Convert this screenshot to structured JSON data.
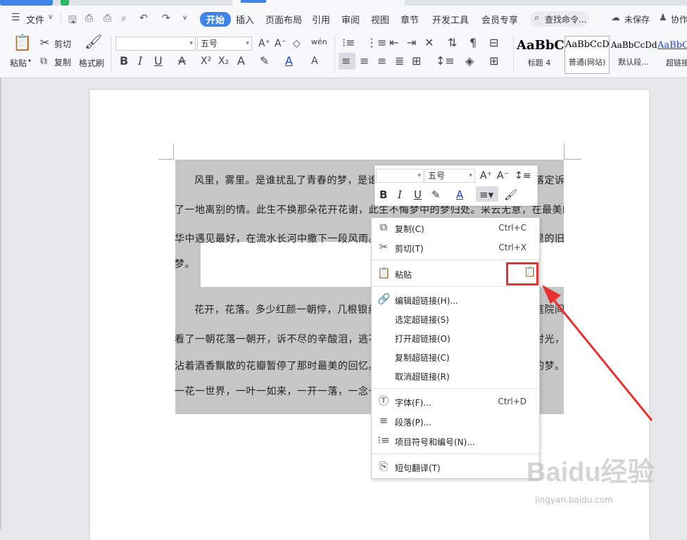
{
  "menubar": {
    "file": "文件",
    "tabs": [
      "开始",
      "插入",
      "页面布局",
      "引用",
      "审阅",
      "视图",
      "章节",
      "开发工具",
      "会员专享"
    ],
    "search": "查找命令...",
    "unsaved": "未保存",
    "collab": "协作"
  },
  "ribbon": {
    "paste": "粘贴",
    "cut": "剪切",
    "copy": "复制",
    "format_painter": "格式刷",
    "font_name": "",
    "font_size": "五号",
    "styles": [
      {
        "sample": "AaBbC",
        "label": "标题 4"
      },
      {
        "sample": "AaBbCcD",
        "label": "普通(网站)"
      },
      {
        "sample": "AaBbCcDd",
        "label": "默认段..."
      },
      {
        "sample": "AaBbCc",
        "label": "超链接"
      }
    ]
  },
  "document": {
    "lines": [
      "风里，雾里。是谁扰乱了青春的梦，是谁看",
      "落定诉",
      "了一地离别的情。此生不换那朵花开花谢，此生不悔梦中的梦归处。采云无意，在最美的年",
      "华中遇见最好，在流水长河中撒下一段风雨。拨",
      "里的旧",
      "梦。",
      "花开，花落。多少红颜一朝悴，几根银丝",
      "庭院间",
      "看了一朝花落一朝开，诉不尽的辛酸泪，逃不",
      "时光，",
      "沾着酒香飘散的花瓣暂停了那时最美的回忆。不",
      "的梦。",
      "一花一世界，一叶一如来，一开一落，一念一"
    ]
  },
  "mini_toolbar": {
    "font_name": "",
    "font_size": "五号"
  },
  "context_menu": {
    "copy": {
      "label": "复制(C)",
      "shortcut": "Ctrl+C"
    },
    "cut": {
      "label": "剪切(T)",
      "shortcut": "Ctrl+X"
    },
    "paste": {
      "label": "粘贴"
    },
    "edit_link": {
      "label": "编辑超链接(H)..."
    },
    "select_link": {
      "label": "选定超链接(S)"
    },
    "open_link": {
      "label": "打开超链接(O)"
    },
    "copy_link": {
      "label": "复制超链接(C)"
    },
    "remove_link": {
      "label": "取消超链接(R)"
    },
    "font": {
      "label": "字体(F)...",
      "shortcut": "Ctrl+D"
    },
    "paragraph": {
      "label": "段落(P)..."
    },
    "bullets": {
      "label": "项目符号和编号(N)..."
    },
    "translate": {
      "label": "短句翻译(T)"
    }
  },
  "watermark": {
    "brand": "Baidu经验",
    "url": "jingyan.baidu.com"
  },
  "colors": {
    "accent": "#3f84e7",
    "highlight_box": "#e8312f",
    "selection": "#c6c6c6"
  }
}
